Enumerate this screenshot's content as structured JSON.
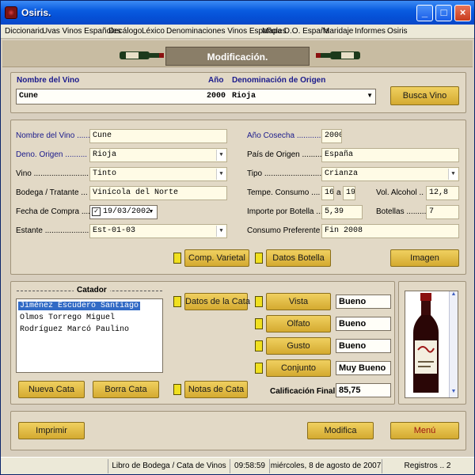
{
  "window": {
    "title": "Osiris."
  },
  "menu": [
    "Diccionario",
    "Uvas Vinos Españoles",
    "Decálogo",
    "Léxico",
    "Denominaciones Vinos Españoles",
    "Mapa D.O. España",
    "Maridaje",
    "Informes",
    "Osiris"
  ],
  "banner": {
    "title": "Modificación."
  },
  "search": {
    "label_name": "Nombre del Vino",
    "label_year": "Año",
    "label_do": "Denominación de Origen",
    "row_name": "Cune",
    "row_year": "2000",
    "row_do": "Rioja",
    "button": "Busca Vino"
  },
  "form": {
    "nombre_label": "Nombre del Vino ......",
    "nombre": "Cune",
    "deno_label": "Deno. Origen ..........",
    "deno": "Rioja",
    "vino_label": "Vino .........................",
    "vino": "Tinto",
    "bodega_label": "Bodega / Tratante ...",
    "bodega": "Vinícola del Norte",
    "fecha_label": "Fecha de Compra ....",
    "fecha": "19/03/2002",
    "estante_label": "Estante .....................",
    "estante": "Est-01-03",
    "cosecha_label": "Año Cosecha ...........",
    "cosecha": "2000",
    "pais_label": "País de Origen ..........",
    "pais": "España",
    "tipo_label": "Tipo ...........................",
    "tipo": "Crianza",
    "temp_label": "Tempe. Consumo ....",
    "temp_min": "16",
    "temp_sep": "a",
    "temp_max": "19",
    "alcohol_label": "Vol. Alcohol ..",
    "alcohol": "12,8",
    "importe_label": "Importe por Botella ...",
    "importe": "5,39",
    "botellas_label": "Botellas .........",
    "botellas": "7",
    "consumo_label": "Consumo Preferente .",
    "consumo": "Fin 2008",
    "btn_varietal": "Comp. Varietal",
    "btn_datos_botella": "Datos Botella",
    "btn_imagen": "Imagen"
  },
  "cata": {
    "catador_label": "Catador",
    "catadores": [
      "Jiménez Escudero Santiago",
      "Olmos Torrego Miguel",
      "Rodríguez Marcó Paulino"
    ],
    "btn_datos_cata": "Datos de la Cata",
    "btn_notas_cata": "Notas de Cata",
    "btn_nueva": "Nueva Cata",
    "btn_borra": "Borra Cata",
    "vista_label": "Vista",
    "vista": "Bueno",
    "olfato_label": "Olfato",
    "olfato": "Bueno",
    "gusto_label": "Gusto",
    "gusto": "Bueno",
    "conjunto_label": "Conjunto",
    "conjunto": "Muy Bueno",
    "final_label": "Calificación Final",
    "final": "85,75"
  },
  "footer": {
    "imprimir": "Imprimir",
    "modifica": "Modifica",
    "menu": "Menú"
  },
  "status": {
    "section": "Libro de Bodega  /  Cata de Vinos",
    "time": "09:58:59",
    "date": "miércoles, 8 de agosto de 2007",
    "records": "Registros .. 2"
  },
  "colors": {
    "accent_gold": "#d4aa30",
    "selection": "#316ac5",
    "menu_red": "#9a1010"
  }
}
